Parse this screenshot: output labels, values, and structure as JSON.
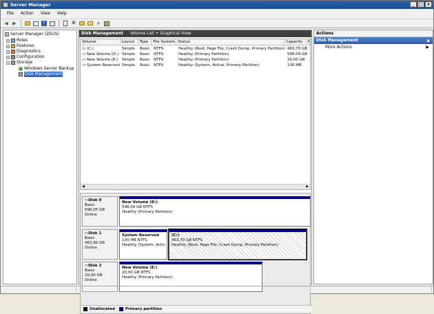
{
  "window": {
    "title": "Server Manager",
    "min": "_",
    "max": "□",
    "close": "×"
  },
  "menu": [
    "File",
    "Action",
    "View",
    "Help"
  ],
  "tree": {
    "root": "Server Manager (ZEUS)",
    "roles": "Roles",
    "features": "Features",
    "diagnostics": "Diagnostics",
    "configuration": "Configuration",
    "storage": "Storage",
    "backup": "Windows Server Backup",
    "disk_mgmt": "Disk Management"
  },
  "center": {
    "title": "Disk Management",
    "subtitle": "Volume List + Graphical View",
    "columns": [
      "Volume",
      "Layout",
      "Type",
      "File System",
      "Status",
      "Capacity",
      "F"
    ],
    "rows": [
      {
        "volume": "(C:)",
        "layout": "Simple",
        "type": "Basic",
        "fs": "NTFS",
        "status": "Healthy (Boot, Page File, Crash Dump, Primary Partition)",
        "capacity": "463,70 GB"
      },
      {
        "volume": "New Volume (D:)",
        "layout": "Simple",
        "type": "Basic",
        "fs": "NTFS",
        "status": "Healthy (Primary Partition)",
        "capacity": "596,04 GB"
      },
      {
        "volume": "New Volume (E:)",
        "layout": "Simple",
        "type": "Basic",
        "fs": "NTFS",
        "status": "Healthy (Primary Partition)",
        "capacity": "20,00 GB"
      },
      {
        "volume": "System Reserved",
        "layout": "Simple",
        "type": "Basic",
        "fs": "NTFS",
        "status": "Healthy (System, Active, Primary Partition)",
        "capacity": "100 MB"
      }
    ]
  },
  "disks": [
    {
      "name": "Disk 0",
      "type": "Basic",
      "size": "596,05 GB",
      "state": "Online",
      "parts": [
        {
          "name": "New Volume  (D:)",
          "size": "596,04 GB NTFS",
          "status": "Healthy (Primary Partition)"
        }
      ]
    },
    {
      "name": "Disk 1",
      "type": "Basic",
      "size": "463,80 GB",
      "state": "Online",
      "parts": [
        {
          "name": "System Reserved",
          "size": "100 MB NTFS",
          "status": "Healthy (System, Activ"
        },
        {
          "name": "(C:)",
          "size": "463,70 GB NTFS",
          "status": "Healthy (Boot, Page File, Crash Dump, Primary Partition)"
        }
      ]
    },
    {
      "name": "Disk 2",
      "type": "Basic",
      "size": "20,00 GB",
      "state": "Online",
      "parts": [
        {
          "name": "New Volume  (E:)",
          "size": "20,00 GB NTFS",
          "status": "Healthy (Primary Partition)"
        }
      ]
    }
  ],
  "legend": {
    "unallocated": "Unallocated",
    "primary": "Primary partition",
    "unallocated_color": "#000000",
    "primary_color": "#00008b"
  },
  "actions": {
    "title": "Actions",
    "section": "Disk Management",
    "more": "More Actions"
  }
}
